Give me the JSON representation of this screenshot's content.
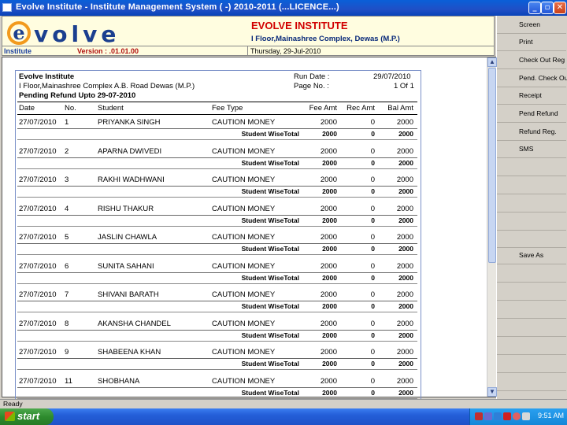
{
  "window": {
    "title": "Evolve Institute - Institute Management System ( -) 2010-2011 (...LICENCE...)",
    "minimize": "_",
    "maximize": "▫",
    "close": "✕"
  },
  "header": {
    "logo_letter": "e",
    "logo_word": "volve",
    "institute_name": "EVOLVE INSTITUTE",
    "institute_address": "I Floor,Mainashree Complex, Dewas (M.P.)",
    "tag": "Institute",
    "version": "Version : .01.01.00",
    "date": "Thursday, 29-Jul-2010"
  },
  "sidepanel": {
    "buttons": [
      "Screen",
      "Print",
      "Check Out Reg",
      "Pend. Check Out",
      "Receipt",
      "Pend Refund",
      "Refund Reg.",
      "SMS",
      "Save As"
    ]
  },
  "report": {
    "institute": "Evolve Institute",
    "address": "I Floor,Mainashree Complex A.B. Road Dewas (M.P.)",
    "title": "Pending Refund Upto 29-07-2010",
    "run_date_label": "Run Date :",
    "run_date": "29/07/2010",
    "page_no_label": "Page No. :",
    "page_no": "1 Of 1",
    "columns": [
      "Date",
      "No.",
      "Student",
      "Fee Type",
      "Fee Amt",
      "Rec Amt",
      "Bal Amt"
    ],
    "subtotal_label": "Student WiseTotal",
    "rows": [
      {
        "date": "27/07/2010",
        "no": "1",
        "student": "PRIYANKA SINGH",
        "fee_type": "CAUTION MONEY",
        "fee_amt": "2000",
        "rec_amt": "0",
        "bal_amt": "2000",
        "sub_fee": "2000",
        "sub_rec": "0",
        "sub_bal": "2000"
      },
      {
        "date": "27/07/2010",
        "no": "2",
        "student": "APARNA  DWIVEDI",
        "fee_type": "CAUTION MONEY",
        "fee_amt": "2000",
        "rec_amt": "0",
        "bal_amt": "2000",
        "sub_fee": "2000",
        "sub_rec": "0",
        "sub_bal": "2000"
      },
      {
        "date": "27/07/2010",
        "no": "3",
        "student": "RAKHI WADHWANI",
        "fee_type": "CAUTION MONEY",
        "fee_amt": "2000",
        "rec_amt": "0",
        "bal_amt": "2000",
        "sub_fee": "2000",
        "sub_rec": "0",
        "sub_bal": "2000"
      },
      {
        "date": "27/07/2010",
        "no": "4",
        "student": "RISHU  THAKUR",
        "fee_type": "CAUTION MONEY",
        "fee_amt": "2000",
        "rec_amt": "0",
        "bal_amt": "2000",
        "sub_fee": "2000",
        "sub_rec": "0",
        "sub_bal": "2000"
      },
      {
        "date": "27/07/2010",
        "no": "5",
        "student": "JASLIN  CHAWLA",
        "fee_type": "CAUTION MONEY",
        "fee_amt": "2000",
        "rec_amt": "0",
        "bal_amt": "2000",
        "sub_fee": "2000",
        "sub_rec": "0",
        "sub_bal": "2000"
      },
      {
        "date": "27/07/2010",
        "no": "6",
        "student": "SUNITA  SAHANI",
        "fee_type": "CAUTION MONEY",
        "fee_amt": "2000",
        "rec_amt": "0",
        "bal_amt": "2000",
        "sub_fee": "2000",
        "sub_rec": "0",
        "sub_bal": "2000"
      },
      {
        "date": "27/07/2010",
        "no": "7",
        "student": "SHIVANI  BARATH",
        "fee_type": "CAUTION MONEY",
        "fee_amt": "2000",
        "rec_amt": "0",
        "bal_amt": "2000",
        "sub_fee": "2000",
        "sub_rec": "0",
        "sub_bal": "2000"
      },
      {
        "date": "27/07/2010",
        "no": "8",
        "student": "AKANSHA CHANDEL",
        "fee_type": "CAUTION MONEY",
        "fee_amt": "2000",
        "rec_amt": "0",
        "bal_amt": "2000",
        "sub_fee": "2000",
        "sub_rec": "0",
        "sub_bal": "2000"
      },
      {
        "date": "27/07/2010",
        "no": "9",
        "student": "SHABEENA KHAN",
        "fee_type": "CAUTION MONEY",
        "fee_amt": "2000",
        "rec_amt": "0",
        "bal_amt": "2000",
        "sub_fee": "2000",
        "sub_rec": "0",
        "sub_bal": "2000"
      },
      {
        "date": "27/07/2010",
        "no": "11",
        "student": "SHOBHANA",
        "fee_type": "CAUTION MONEY",
        "fee_amt": "2000",
        "rec_amt": "0",
        "bal_amt": "2000",
        "sub_fee": "2000",
        "sub_rec": "0",
        "sub_bal": "2000"
      }
    ]
  },
  "statusbar": {
    "text": "Ready"
  },
  "taskbar": {
    "start_label": "start",
    "clock": "9:51 AM"
  }
}
